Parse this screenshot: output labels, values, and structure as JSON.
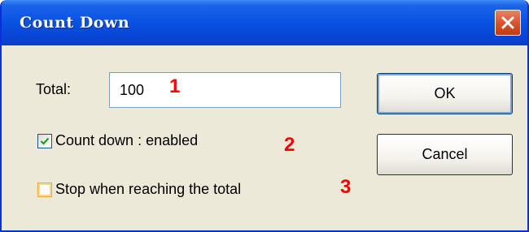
{
  "window": {
    "title": "Count Down",
    "close_icon": "close-icon"
  },
  "form": {
    "total_label": "Total:",
    "total_value": "100",
    "count_down_label": "Count down : enabled",
    "count_down_checked": true,
    "stop_label": "Stop when reaching the total",
    "stop_checked": false
  },
  "buttons": {
    "ok_label": "OK",
    "cancel_label": "Cancel"
  },
  "annotations": [
    "1",
    "2",
    "3"
  ],
  "colors": {
    "annotation": "#ff0000",
    "titlebar": "#0a54e3",
    "window_bg": "#ece9d8"
  }
}
